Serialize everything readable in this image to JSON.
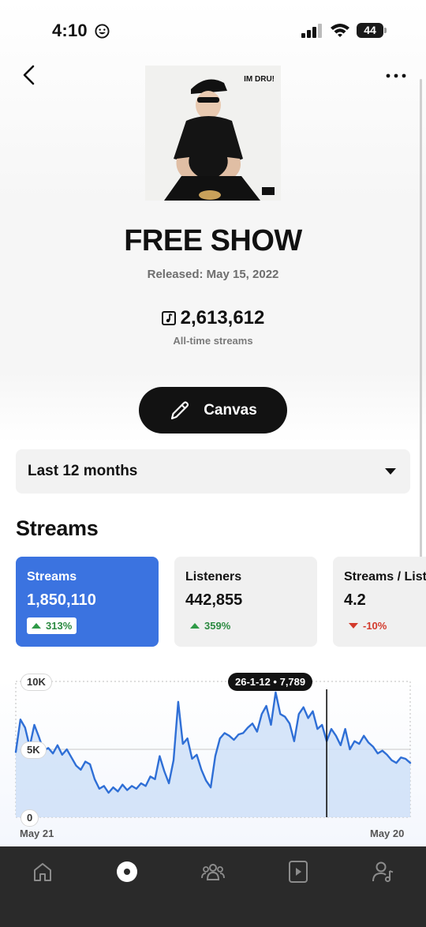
{
  "status_bar": {
    "time": "4:10",
    "battery": "44"
  },
  "song": {
    "cover_text": "IM DRU!",
    "title": "FREE SHOW",
    "release_date": "Released: May 15, 2022",
    "alltime_streams": "2,613,612",
    "alltime_label": "All-time streams"
  },
  "canvas_button": {
    "label": "Canvas"
  },
  "range_select": {
    "selected": "Last 12 months"
  },
  "section": {
    "title": "Streams"
  },
  "metrics": [
    {
      "title": "Streams",
      "value": "1,850,110",
      "change": "313%",
      "direction": "up",
      "active": true
    },
    {
      "title": "Listeners",
      "value": "442,855",
      "change": "359%",
      "direction": "up",
      "active": false
    },
    {
      "title": "Streams / Listener",
      "value": "4.2",
      "change": "-10%",
      "direction": "down",
      "active": false
    }
  ],
  "colors": {
    "accent": "#3b73e0",
    "line": "#2f6fd6",
    "fill": "#cfe0f8",
    "positive": "#2c8a41",
    "negative": "#d33a2c"
  },
  "chart_data": {
    "type": "area",
    "ylim": [
      0,
      10000
    ],
    "y_ticks": [
      "10K",
      "5K",
      "0"
    ],
    "x_labels": [
      "May 21",
      "May 20"
    ],
    "tooltip": {
      "date": "26-1-12",
      "value": "7,789",
      "label": "26-1-12 • 7,789"
    },
    "grid": true,
    "series": [
      {
        "values": [
          4800,
          7200,
          6600,
          5200,
          6800,
          5900,
          4900,
          5100,
          4700,
          5300,
          4600,
          5000,
          4400,
          3800,
          3500,
          4100,
          3900,
          2800,
          2100,
          2300,
          1800,
          2200,
          1900,
          2400,
          2000,
          2300,
          2100,
          2500,
          2300,
          3000,
          2800,
          4500,
          3400,
          2500,
          4200,
          8500,
          5400,
          5800,
          4300,
          4600,
          3500,
          2700,
          2200,
          4500,
          5800,
          6200,
          6000,
          5700,
          6100,
          6200,
          6600,
          6900,
          6300,
          7600,
          8200,
          6800,
          9200,
          7600,
          7400,
          6900,
          5600,
          7600,
          8100,
          7300,
          7800,
          6500,
          6800,
          5600,
          6500,
          6000,
          5300,
          6500,
          5000,
          5600,
          5400,
          6000,
          5500,
          5200,
          4700,
          4900,
          4600,
          4200,
          4000,
          4400,
          4300,
          4000
        ],
        "highlight_index": 67
      }
    ]
  },
  "tab_bar": {
    "tabs": [
      {
        "icon": "home-icon",
        "active": false
      },
      {
        "icon": "music-disc-icon",
        "active": true
      },
      {
        "icon": "audience-icon",
        "active": false
      },
      {
        "icon": "video-play-icon",
        "active": false
      },
      {
        "icon": "profile-music-icon",
        "active": false
      }
    ]
  }
}
